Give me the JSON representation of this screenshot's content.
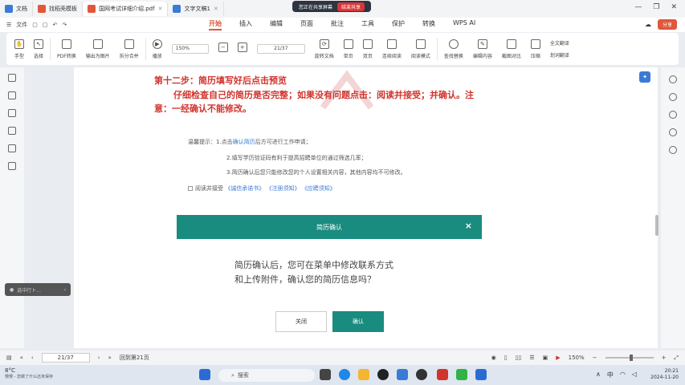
{
  "tabs": [
    {
      "label": "文档",
      "color": "#3a7bd5"
    },
    {
      "label": "找稻壳模板",
      "color": "#e0573a"
    },
    {
      "label": "国网考试详细介绍.pdf",
      "color": "#e0573a"
    },
    {
      "label": "文字文稿1",
      "color": "#3a7bd5"
    }
  ],
  "share_bar": {
    "status": "您正在共享屏幕",
    "end_label": "结束共享"
  },
  "menu": {
    "file_label": "文件",
    "items": [
      "开始",
      "插入",
      "编辑",
      "页面",
      "批注",
      "工具",
      "保护",
      "转换"
    ],
    "active_index": 0,
    "wps_ai": "WPS AI",
    "share_label": "分享"
  },
  "toolbar": {
    "hand": "手型",
    "select": "选择",
    "pdf_convert": "PDF转换",
    "export_image": "输出为图片",
    "split_merge": "拆分合并",
    "play": "播放",
    "zoom": "150%",
    "page": "21/37",
    "rotate": "旋转文档",
    "single_page": "单页",
    "double_page": "双页",
    "continuous": "连续阅读",
    "read_mode": "阅读模式",
    "find_replace": "查找替换",
    "edit_content": "编辑内容",
    "screenshot_compare": "截图对比",
    "compress": "压缩",
    "full_translate": "全文翻译",
    "word_translate": "划词翻译"
  },
  "document": {
    "heading": "第十二步：简历填写好后点击预览",
    "instruction_line1": "仔细检查自己的简历是否完整；如果没有问题点击：阅读并接受；并确认。注",
    "instruction_line2": "意：一经确认不能修改。",
    "tip_prefix": "温馨提示：1.点击",
    "tip_link": "确认简历",
    "tip_suffix": "后方可进行工作申请；",
    "tip2": "2.填写学历验证码有利于提高招聘单位的通过筛选几率；",
    "tip3": "3.简历确认后您只能修改您的个人设置相关内容，其他内容均不可修改。",
    "accept_label": "阅读并接受",
    "accept_links": [
      "《诚信承诺书》",
      "《注册须知》",
      "《应聘须知》"
    ],
    "modal_title": "简历确认",
    "modal_close": "×",
    "modal_text_line1": "简历确认后，您可在菜单中修改联系方式",
    "modal_text_line2": "和上传附件，确认您的简历信息吗？",
    "btn_close": "关闭",
    "btn_confirm": "确认"
  },
  "float_panel": {
    "placeholder": "选中行ト..."
  },
  "statusbar": {
    "page": "21/37",
    "goto": "回到第21页",
    "zoom": "150%"
  },
  "taskbar": {
    "weather_temp": "8°C",
    "weather_sub": "慢慢 - 您做了什么还未保存",
    "search_placeholder": "搜索",
    "ime": "中",
    "time": "20:21",
    "date": "2024-11-20"
  }
}
